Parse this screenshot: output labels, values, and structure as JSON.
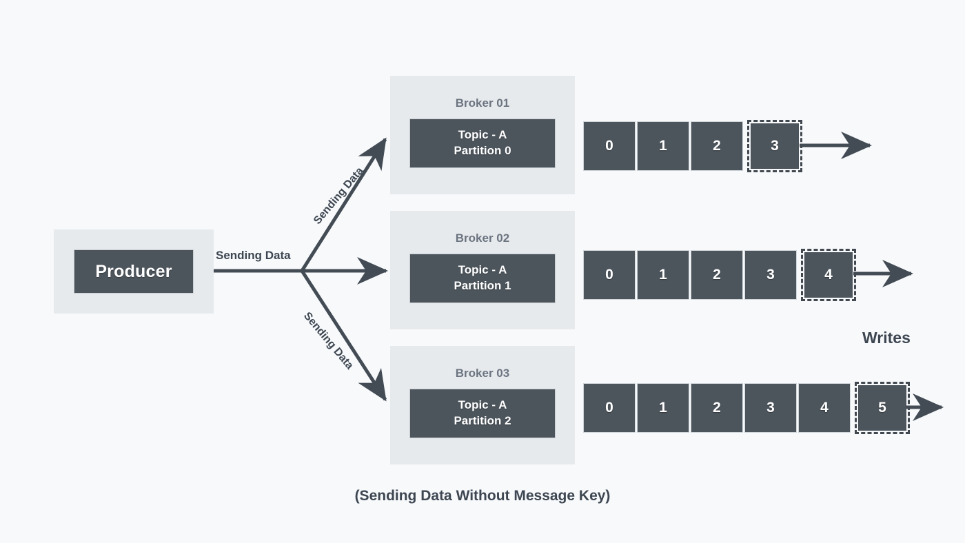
{
  "diagram": {
    "caption": "(Sending Data Without Message Key)",
    "writes_label": "Writes",
    "background_color": "#f7f9fb",
    "panel_color": "#e7eaed",
    "box_color": "#4c545c",
    "text_color": "#3d4651"
  },
  "producer": {
    "label": "Producer"
  },
  "flow_labels": {
    "middle": "Sending Data",
    "upper": "Sending Data",
    "lower": "Sending Data"
  },
  "brokers": [
    {
      "title": "Broker 01",
      "topic": "Topic - A",
      "partition": "Partition 0",
      "offsets": [
        "0",
        "1",
        "2"
      ],
      "pending_offset": "3"
    },
    {
      "title": "Broker 02",
      "topic": "Topic - A",
      "partition": "Partition 1",
      "offsets": [
        "0",
        "1",
        "2",
        "3"
      ],
      "pending_offset": "4"
    },
    {
      "title": "Broker 03",
      "topic": "Topic - A",
      "partition": "Partition 2",
      "offsets": [
        "0",
        "1",
        "2",
        "3",
        "4"
      ],
      "pending_offset": "5"
    }
  ]
}
